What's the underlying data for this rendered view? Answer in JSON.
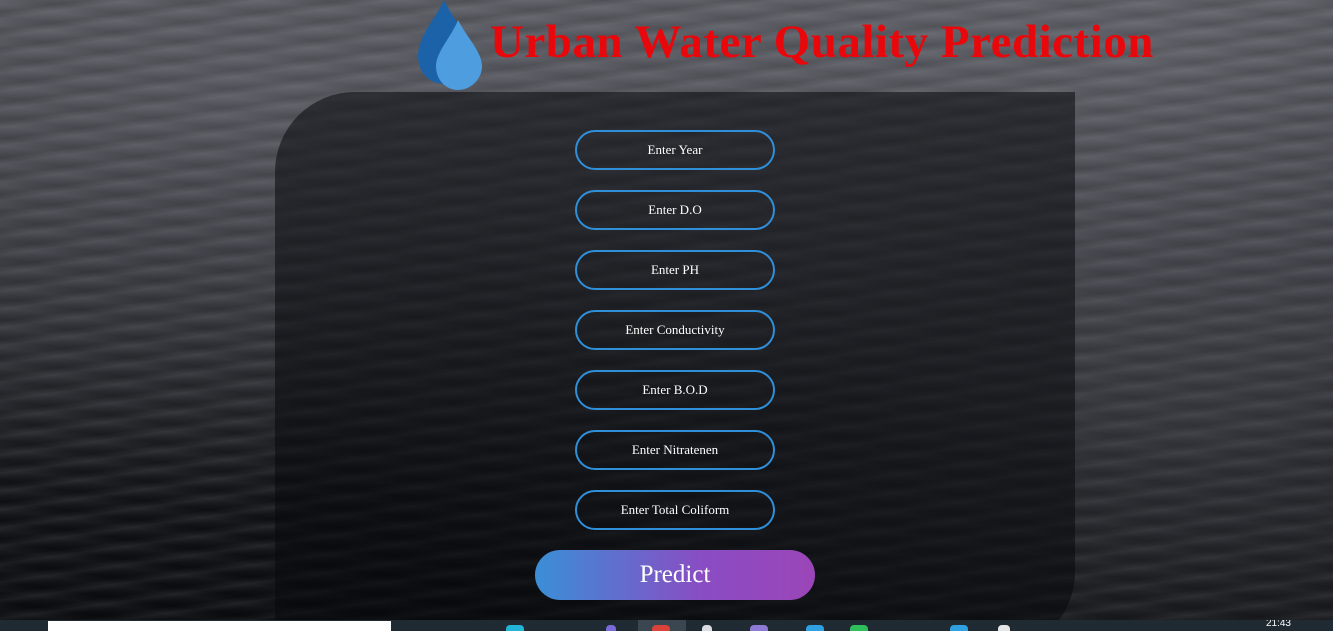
{
  "header": {
    "title": "Urban Water Quality Prediction",
    "logo_icon": "water-drop-icon",
    "title_color": "#e8080c"
  },
  "form": {
    "fields": [
      {
        "name": "year",
        "placeholder": "Enter Year"
      },
      {
        "name": "do",
        "placeholder": "Enter D.O"
      },
      {
        "name": "ph",
        "placeholder": "Enter PH"
      },
      {
        "name": "conductivity",
        "placeholder": "Enter Conductivity"
      },
      {
        "name": "bod",
        "placeholder": "Enter B.O.D"
      },
      {
        "name": "nitratenen",
        "placeholder": "Enter Nitratenen"
      },
      {
        "name": "total_coliform",
        "placeholder": "Enter Total Coliform"
      }
    ],
    "submit_label": "Predict",
    "field_border_color": "#2f8fd8",
    "button_gradient": [
      "#3a8fd6",
      "#9b46b8"
    ]
  },
  "taskbar": {
    "clock": "21:43"
  }
}
